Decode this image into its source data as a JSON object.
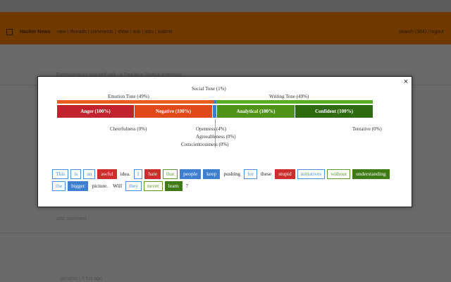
{
  "hn": {
    "title": "Hacker News",
    "nav": "new | threads | comments | show | ask | jobs | submit",
    "user": "search (384) | logout",
    "story_line": "Entrepreneurs and self-talk - a Fearless Startup interview",
    "comment_label": "add comment",
    "footer_line": "jsmarks | 3 hrs ago"
  },
  "modal": {
    "close": "×",
    "social_tone": "Social Tone (1%)",
    "emotion_tone": "Emotion Tone (49%)",
    "writing_tone": "Writing Tone (49%)",
    "segments": [
      {
        "label": "Anger (100%)",
        "color": "#c0232e"
      },
      {
        "label": "Negative (100%)",
        "color": "#e0491a"
      },
      {
        "label": "Analytical (100%)",
        "color": "#4e9318"
      },
      {
        "label": "Confident (100%)",
        "color": "#2e6a10"
      }
    ],
    "below": {
      "cheerfulness": "Cheerfulness (0%)",
      "openness": "Openness (4%)",
      "agreeableness": "Agreeableness (0%)",
      "conscientiousness": "Conscientiousness (0%)",
      "tentative": "Tentative (0%)"
    },
    "words": [
      {
        "t": "This",
        "s": "blue"
      },
      {
        "t": "is",
        "s": "blue"
      },
      {
        "t": "an",
        "s": "blue"
      },
      {
        "t": "awful",
        "s": "red-f"
      },
      {
        "t": "idea.",
        "s": "plain"
      },
      {
        "t": "I",
        "s": "blue"
      },
      {
        "t": "hate",
        "s": "red-f"
      },
      {
        "t": "that",
        "s": "green"
      },
      {
        "t": "people",
        "s": "blue-f"
      },
      {
        "t": "keep",
        "s": "blue-f"
      },
      {
        "t": "pushing",
        "s": "plain"
      },
      {
        "t": "for",
        "s": "blue"
      },
      {
        "t": "these",
        "s": "plain"
      },
      {
        "t": "stupid",
        "s": "red-f"
      },
      {
        "t": "initiatives",
        "s": "blue"
      },
      {
        "t": "without",
        "s": "green"
      },
      {
        "t": "understanding",
        "s": "green-f"
      },
      {
        "t": "the",
        "s": "blue"
      },
      {
        "t": "bigger",
        "s": "blue-f"
      },
      {
        "t": "picture.",
        "s": "plain"
      },
      {
        "t": "Will",
        "s": "plain"
      },
      {
        "t": "they",
        "s": "blue"
      },
      {
        "t": "never",
        "s": "green"
      },
      {
        "t": "learn",
        "s": "green-f"
      },
      {
        "t": "?",
        "s": "plain"
      }
    ]
  },
  "colors": {
    "emotion_bar": "#e95e1d",
    "social_bar": "#3f7fcf",
    "writing_bar": "#5aae24"
  }
}
